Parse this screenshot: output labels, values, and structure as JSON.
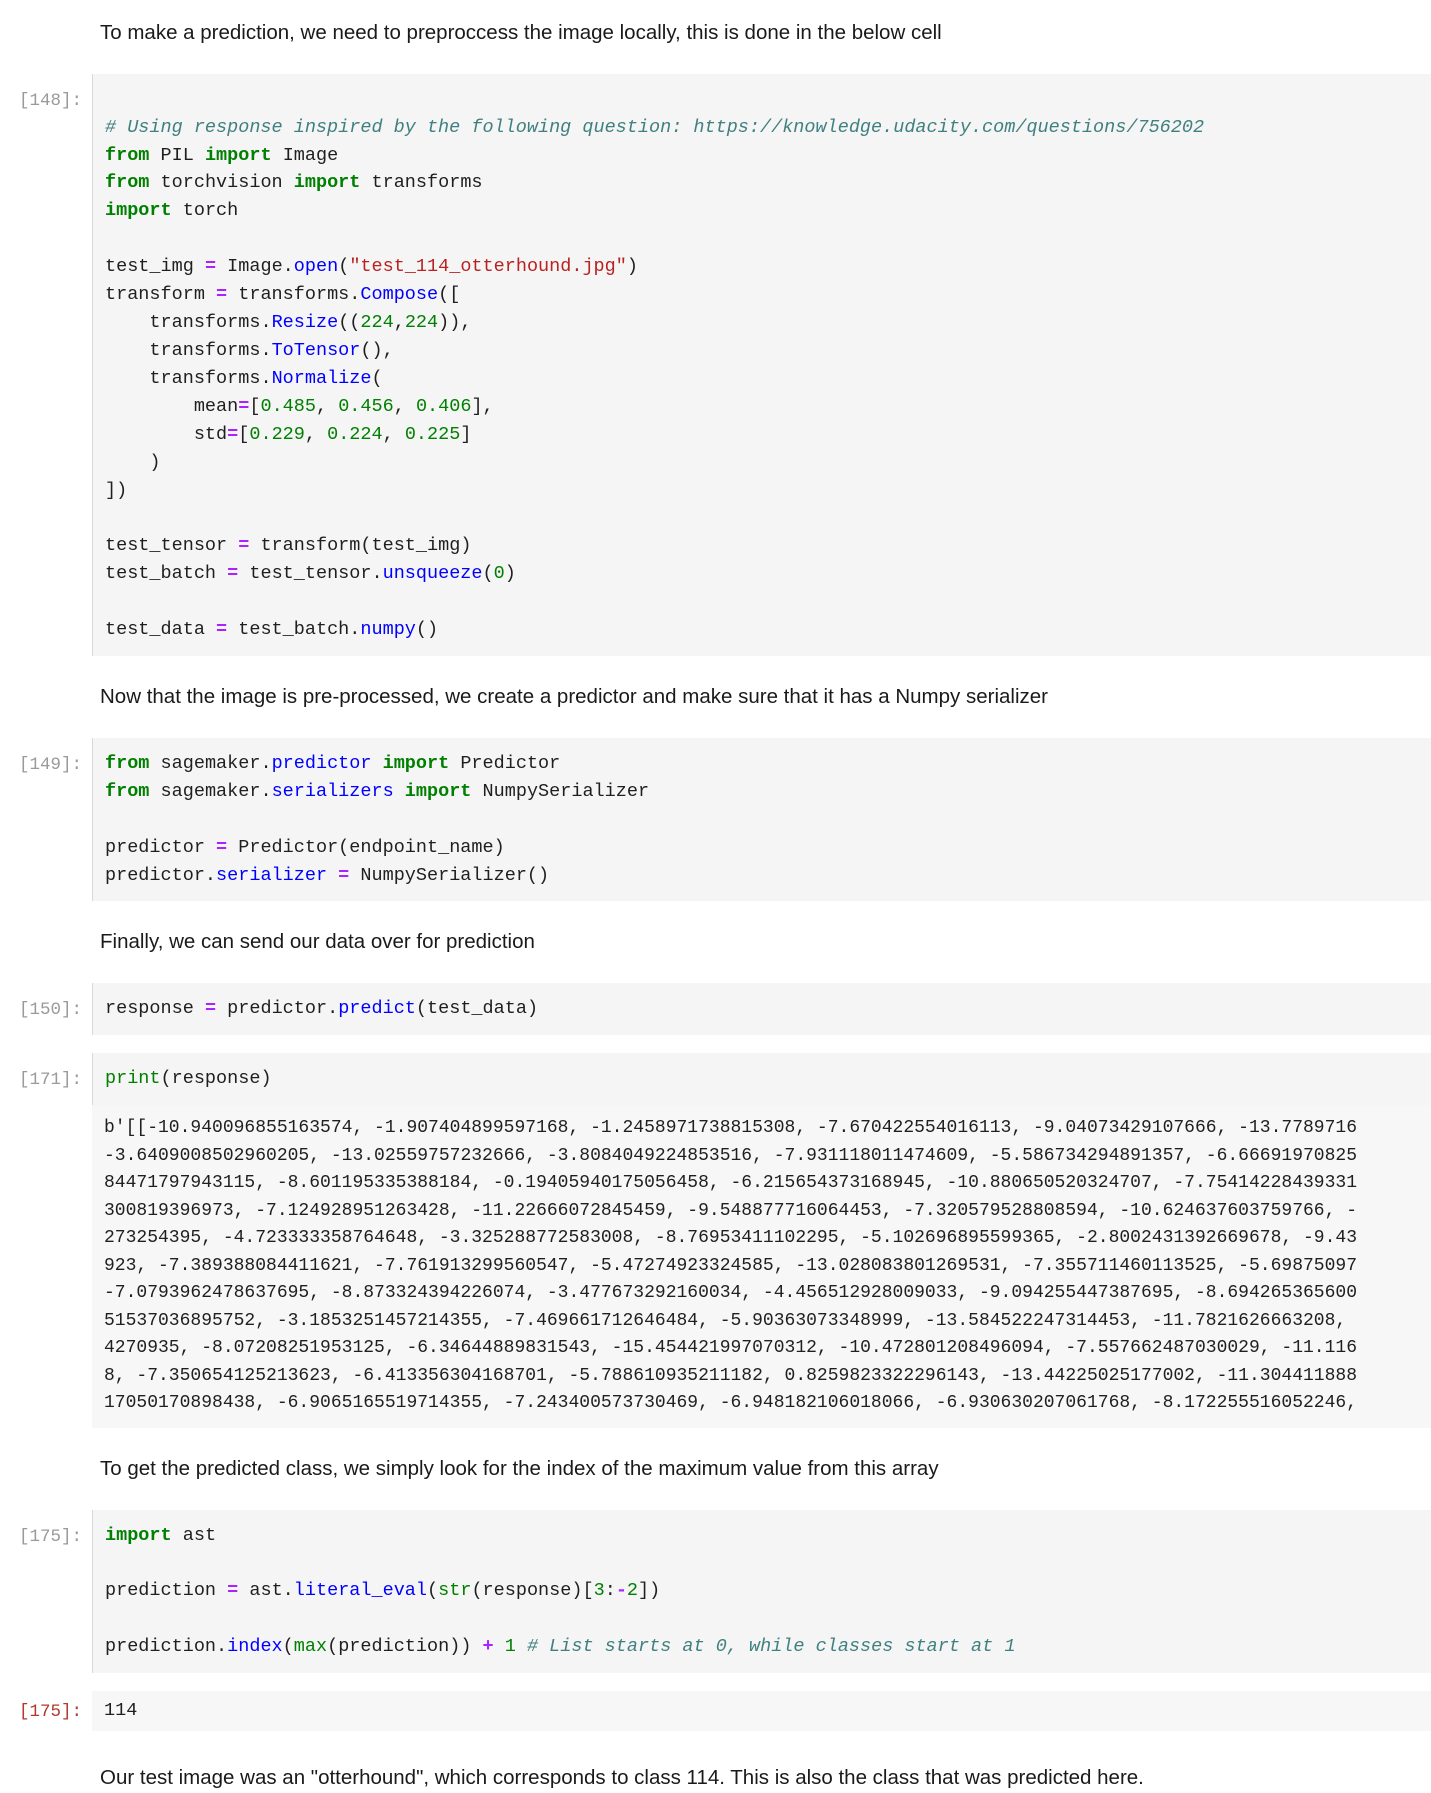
{
  "notebook": {
    "markdown": {
      "intro_preprocess": "To make a prediction, we need to preproccess the image locally, this is done in the below cell",
      "predictor_note": "Now that the image is pre-processed, we create a predictor and make sure that it has a Numpy serializer",
      "send_note": "Finally, we can send our data over for prediction",
      "argmax_note": "To get the predicted class, we simply look for the index of the maximum value from this array",
      "conclusion": "Our test image was an \"otterhound\", which corresponds to class 114. This is also the class that was predicted here."
    },
    "cells": [
      {
        "prompt": "[148]:",
        "id": "cell-148",
        "code_lines": [
          "# Using response inspired by the following question: https://knowledge.udacity.com/questions/756202",
          "from PIL import Image",
          "from torchvision import transforms",
          "import torch",
          "",
          "test_img = Image.open(\"test_114_otterhound.jpg\")",
          "transform = transforms.Compose([",
          "    transforms.Resize((224,224)),",
          "    transforms.ToTensor(),",
          "    transforms.Normalize(",
          "        mean=[0.485, 0.456, 0.406],",
          "        std=[0.229, 0.224, 0.225]",
          "    )",
          "])",
          "",
          "test_tensor = transform(test_img)",
          "test_batch = test_tensor.unsqueeze(0)",
          "",
          "test_data = test_batch.numpy()"
        ]
      },
      {
        "prompt": "[149]:",
        "id": "cell-149",
        "code_lines": [
          "from sagemaker.predictor import Predictor",
          "from sagemaker.serializers import NumpySerializer",
          "",
          "predictor = Predictor(endpoint_name)",
          "predictor.serializer = NumpySerializer()"
        ]
      },
      {
        "prompt": "[150]:",
        "id": "cell-150",
        "code_lines": [
          "response = predictor.predict(test_data)"
        ]
      },
      {
        "prompt": "[171]:",
        "id": "cell-171",
        "code_lines": [
          "print(response)"
        ]
      },
      {
        "prompt": "[175]:",
        "id": "cell-175",
        "code_lines": [
          "import ast",
          "",
          "prediction = ast.literal_eval(str(response)[3:-2])",
          "",
          "prediction.index(max(prediction)) + 1 # List starts at 0, while classes start at 1"
        ]
      }
    ],
    "outputs": {
      "response_stream": "b'[[-10.940096855163574, -1.907404899597168, -1.2458971738815308, -7.670422554016113, -9.04073429107666, -13.7789716\n-3.6409008502960205, -13.02559757232666, -3.8084049224853516, -7.931118011474609, -5.586734294891357, -6.66691970825\n84471797943115, -8.601195335388184, -0.19405940175056458, -6.215654373168945, -10.880650520324707, -7.75414228439331\n300819396973, -7.124928951263428, -11.22666072845459, -9.548877716064453, -7.320579528808594, -10.624637603759766, -\n273254395, -4.723333358764648, -3.325288772583008, -8.76953411102295, -5.102696895599365, -2.8002431392669678, -9.43\n923, -7.389388084411621, -7.761913299560547, -5.47274923324585, -13.028083801269531, -7.355711460113525, -5.69875097\n-7.0793962478637695, -8.873324394226074, -3.477673292160034, -4.456512928009033, -9.094255447387695, -8.694265365600\n51537036895752, -3.1853251457214355, -7.469661712646484, -5.90363073348999, -13.584522247314453, -11.7821626663208,\n4270935, -8.07208251953125, -6.34644889831543, -15.454421997070312, -10.472801208496094, -7.557662487030029, -11.116\n8, -7.350654125213623, -6.413356304168701, -5.788610935211182, 0.8259823322296143, -13.44225025177002, -11.304411888\n17050170898438, -6.9065165519714355, -7.243400573730469, -6.948182106018066, -6.930630207061768, -8.172255516052246,",
      "result_175_prompt": "[175]:",
      "result_175_value": "114"
    }
  },
  "colors": {
    "cell_background": "#f5f5f5",
    "output_background": "#f7f7f7",
    "prompt_in": "#9a9a9a",
    "prompt_out": "#b03a2e",
    "comment": "#408080",
    "keyword": "#008000",
    "string": "#ba2121",
    "function": "#0000ff",
    "operator": "#aa22ff",
    "number": "#008000"
  }
}
